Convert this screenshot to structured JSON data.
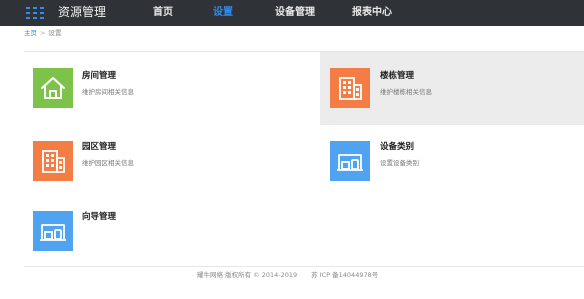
{
  "header": {
    "app_title": "资源管理",
    "logo_icon": "grid-menu-icon",
    "accent_color": "#2f8cf0",
    "background_color": "#2f3338",
    "nav": [
      {
        "label": "首页",
        "active": false
      },
      {
        "label": "设置",
        "active": true
      },
      {
        "label": "设备管理",
        "active": false
      },
      {
        "label": "报表中心",
        "active": false
      }
    ]
  },
  "breadcrumb": {
    "home": "主页",
    "separator": ">",
    "current": "设置"
  },
  "cards": [
    {
      "title": "房间管理",
      "description": "维护房间相关信息",
      "icon": "house-icon",
      "color": "#7ec349"
    },
    {
      "title": "楼栋管理",
      "description": "维护楼栋相关信息",
      "icon": "building-icon",
      "color": "#f37d45",
      "highlighted": true
    },
    {
      "title": "园区管理",
      "description": "维护园区相关信息",
      "icon": "building-icon",
      "color": "#f37d45"
    },
    {
      "title": "设备类别",
      "description": "设置设备类别",
      "icon": "device-icon",
      "color": "#4fa3f1"
    },
    {
      "title": "向导管理",
      "description": "",
      "icon": "device-icon",
      "color": "#4fa3f1"
    }
  ],
  "footer": {
    "copyright": "耀牛网络·版权所有 © 2014-2019",
    "icp": "苏 ICP 备14044978号"
  }
}
